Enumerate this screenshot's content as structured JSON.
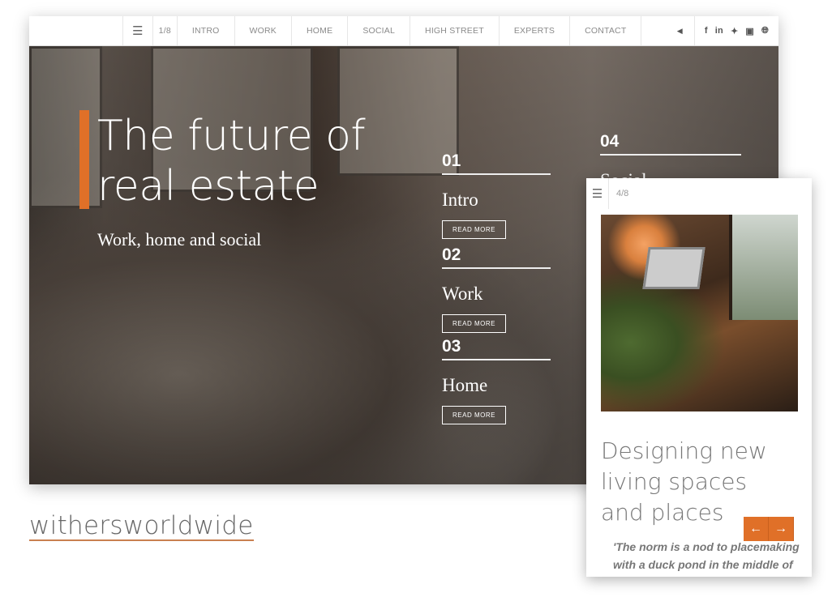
{
  "nav": {
    "page": "1/8",
    "items": [
      "INTRO",
      "WORK",
      "HOME",
      "SOCIAL",
      "HIGH STREET",
      "EXPERTS",
      "CONTACT"
    ],
    "icons": [
      "menu-icon",
      "speaker-icon",
      "facebook-icon",
      "linkedin-icon",
      "twitter-icon",
      "instagram-icon",
      "globe-icon"
    ]
  },
  "hero": {
    "title_line1": "The future of",
    "title_line2": "real estate",
    "subtitle": "Work, home and social",
    "sections": [
      {
        "num": "01",
        "title": "Intro",
        "button": "READ MORE"
      },
      {
        "num": "02",
        "title": "Work",
        "button": "READ MORE"
      },
      {
        "num": "03",
        "title": "Home",
        "button": "READ MORE"
      },
      {
        "num": "04",
        "title": "Social"
      }
    ]
  },
  "mobile": {
    "page": "4/8",
    "title": "Designing new living spaces and places",
    "quote_line1": "'The norm is a nod to placemaking",
    "quote_line2": "with a duck pond in the middle of"
  },
  "logo": "withersworldwide",
  "colors": {
    "accent": "#e07028"
  }
}
